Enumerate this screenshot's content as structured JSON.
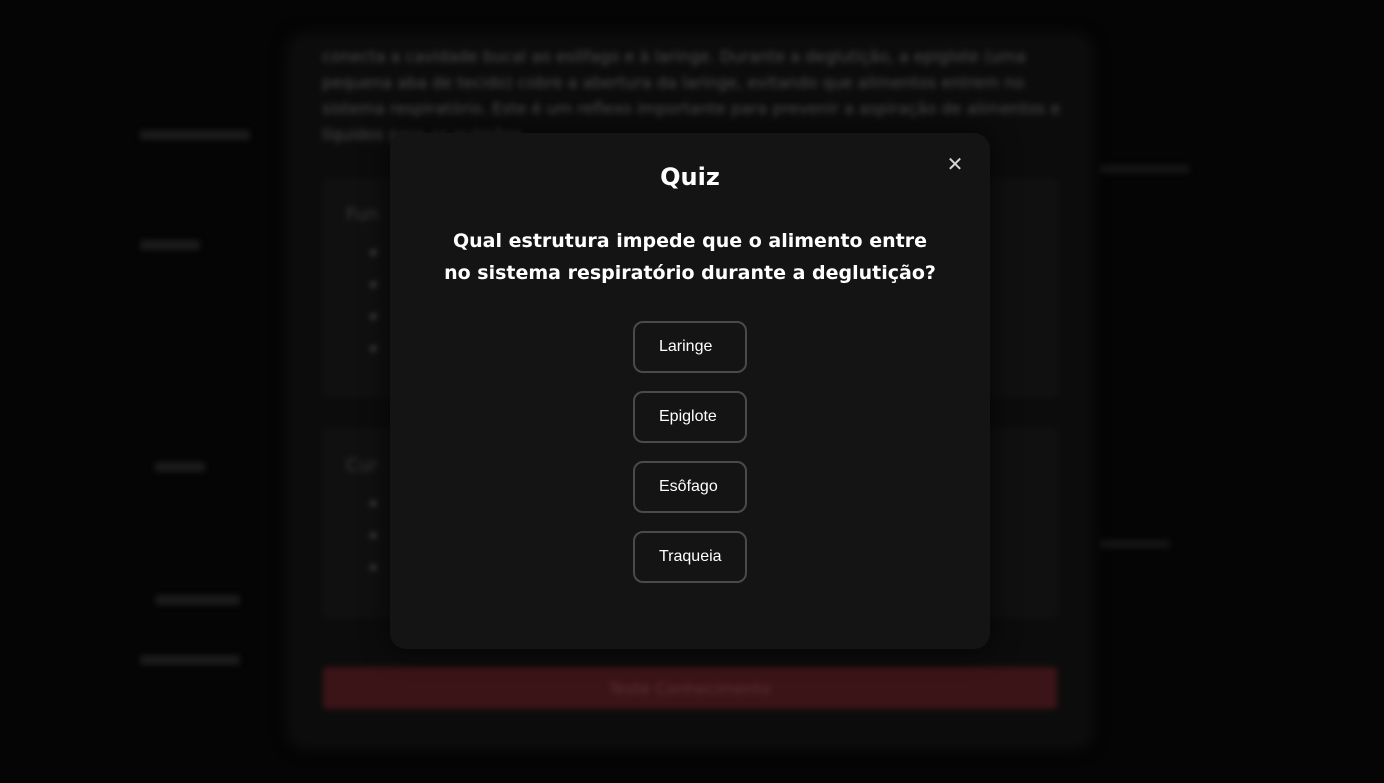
{
  "background": {
    "paragraph": "conecta a cavidade bucal ao esôfago e à laringe. Durante a deglutição, a epiglote (uma pequena aba de tecido) cobre a abertura da laringe, evitando que alimentos entrem no sistema respiratório. Este é um reflexo importante para prevenir a aspiração de alimentos e líquidos para os pulmões.",
    "action_button_label": "Teste Conhecimento",
    "accent_color": "#3b1417"
  },
  "modal": {
    "title": "Quiz",
    "question": "Qual estrutura impede que o alimento entre no sistema respiratório durante a deglutição?",
    "close_icon": "close-icon",
    "close_glyph": "✕",
    "options": [
      {
        "label": "Laringe"
      },
      {
        "label": "Epiglote"
      },
      {
        "label": "Esôfago"
      },
      {
        "label": "Traqueia"
      }
    ],
    "background_color": "#141414",
    "option_border_color": "#4a4a4a"
  }
}
